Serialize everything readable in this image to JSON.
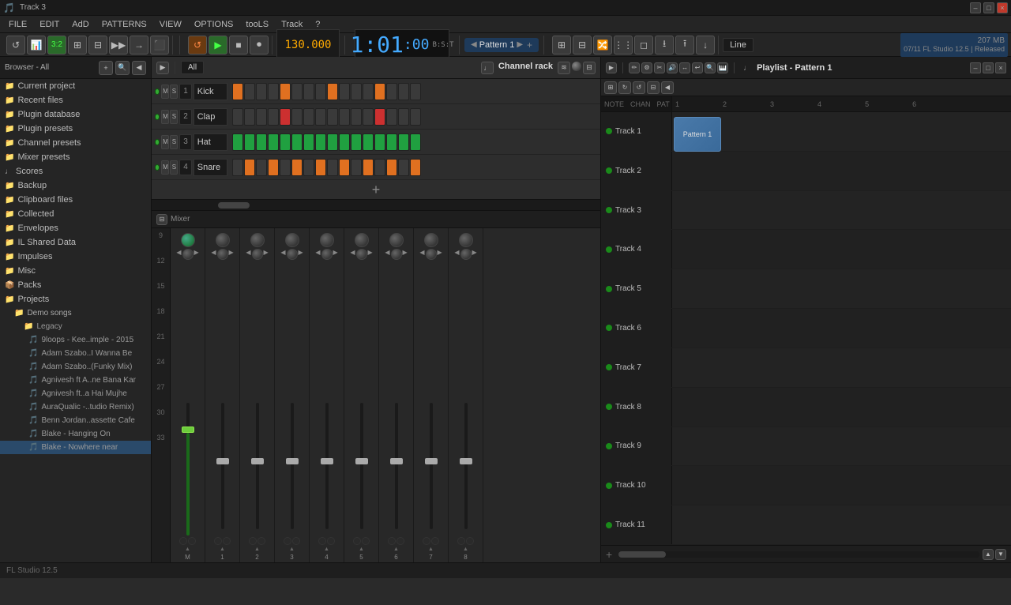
{
  "titlebar": {
    "title": "Track 3",
    "minimize": "–",
    "maximize": "□",
    "close": "×"
  },
  "menubar": {
    "items": [
      "FILE",
      "EDIT",
      "ADD",
      "PATTERNS",
      "VIEW",
      "OPTIONS",
      "TOOLS",
      "?"
    ]
  },
  "toolbar": {
    "snap_value": "3.2",
    "bpm": "130.000",
    "time": "1:01",
    "time_sub": "00",
    "time_prefix": "B:S:T",
    "pattern": "Pattern 1",
    "version": "07/11  FL Studio 12.5 | Released",
    "mem": "207 MB",
    "line_mode": "Line",
    "cpu": "1",
    "bar_top": "0"
  },
  "sidebar": {
    "header": "Browser - All",
    "items": [
      {
        "label": "Current project",
        "type": "folder",
        "icon": "📁"
      },
      {
        "label": "Recent files",
        "type": "folder",
        "icon": "📁"
      },
      {
        "label": "Plugin database",
        "type": "folder",
        "icon": "📁"
      },
      {
        "label": "Plugin presets",
        "type": "folder",
        "icon": "📁"
      },
      {
        "label": "Channel presets",
        "type": "folder",
        "icon": "📁"
      },
      {
        "label": "Mixer presets",
        "type": "folder",
        "icon": "📁"
      },
      {
        "label": "Scores",
        "type": "folder",
        "icon": "♩"
      },
      {
        "label": "Backup",
        "type": "folder",
        "icon": "📁"
      },
      {
        "label": "Clipboard files",
        "type": "folder",
        "icon": "📁"
      },
      {
        "label": "Collected",
        "type": "folder",
        "icon": "📁"
      },
      {
        "label": "Envelopes",
        "type": "folder",
        "icon": "📁"
      },
      {
        "label": "IL Shared Data",
        "type": "folder",
        "icon": "📁"
      },
      {
        "label": "Impulses",
        "type": "folder",
        "icon": "📁"
      },
      {
        "label": "Misc",
        "type": "folder",
        "icon": "📁"
      },
      {
        "label": "Packs",
        "type": "folder",
        "icon": "📦"
      },
      {
        "label": "Projects",
        "type": "folder",
        "icon": "📁"
      },
      {
        "label": "Demo songs",
        "type": "subfolder",
        "icon": "📁"
      },
      {
        "label": "Legacy",
        "type": "subsubfolder",
        "icon": "📁"
      },
      {
        "label": "9loops - Kee..imple - 2015",
        "type": "file",
        "icon": "🎵"
      },
      {
        "label": "Adam Szabo..I Wanna Be",
        "type": "file",
        "icon": "🎵"
      },
      {
        "label": "Adam Szabo..(Funky Mix)",
        "type": "file",
        "icon": "🎵"
      },
      {
        "label": "Agnivesh ft A..ne Bana Kar",
        "type": "file",
        "icon": "🎵"
      },
      {
        "label": "Agnivesh ft..a Hai Mujhe",
        "type": "file",
        "icon": "🎵"
      },
      {
        "label": "AuraQualic -..tudio Remix)",
        "type": "file",
        "icon": "🎵"
      },
      {
        "label": "Benn Jordan..assette Cafe",
        "type": "file",
        "icon": "🎵"
      },
      {
        "label": "Blake - Hanging On",
        "type": "file",
        "icon": "🎵"
      },
      {
        "label": "Blake - Nowhere near",
        "type": "file",
        "icon": "🎵"
      }
    ]
  },
  "channel_rack": {
    "title": "Channel rack",
    "filter": "All",
    "channels": [
      {
        "num": 1,
        "name": "Kick",
        "color": "#e07020"
      },
      {
        "num": 2,
        "name": "Clap",
        "color": "#cc3030"
      },
      {
        "num": 3,
        "name": "Hat",
        "color": "#20a040"
      },
      {
        "num": 4,
        "name": "Snare",
        "color": "#e07020"
      }
    ],
    "pad_count": 16
  },
  "mixer": {
    "title": "Mixer",
    "channels": [
      "M",
      "1",
      "2",
      "3",
      "4",
      "5",
      "6",
      "7",
      "8"
    ]
  },
  "playlist": {
    "title": "Playlist - Pattern 1",
    "tracks": [
      {
        "name": "Track 1"
      },
      {
        "name": "Track 2"
      },
      {
        "name": "Track 3"
      },
      {
        "name": "Track 4"
      },
      {
        "name": "Track 5"
      },
      {
        "name": "Track 6"
      },
      {
        "name": "Track 7"
      },
      {
        "name": "Track 8"
      },
      {
        "name": "Track 9"
      },
      {
        "name": "Track 10"
      },
      {
        "name": "Track 11"
      }
    ],
    "ruler": [
      "1",
      "2",
      "3",
      "4",
      "5",
      "6"
    ],
    "pattern_name": "Pattern 1",
    "header_cols": [
      "NOTE",
      "CHAN",
      "PAT"
    ]
  }
}
